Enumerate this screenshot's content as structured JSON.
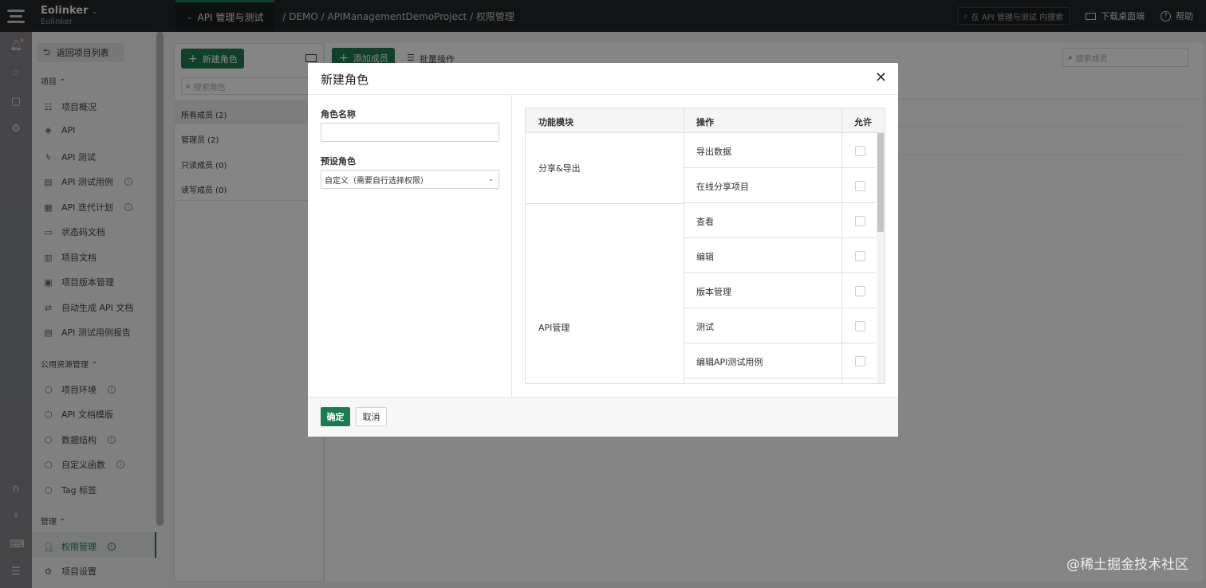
{
  "topbar": {
    "brand_name": "Eolinker",
    "brand_sub": "Eolinker",
    "active_tab": "API 管理与测试",
    "breadcrumb": "/ DEMO / APIManagementDemoProject / 权限管理",
    "search_placeholder": "在 API 管理与测试 内搜索",
    "download_label": "下载桌面端",
    "help_label": "帮助"
  },
  "nav": {
    "back_label": "返回项目列表",
    "group_project": "项目",
    "group_public": "公用资源管理",
    "group_manage": "管理",
    "items": [
      {
        "label": "项目概况",
        "icon": "list-icon"
      },
      {
        "label": "API",
        "icon": "tag-icon"
      },
      {
        "label": "API 测试",
        "icon": "bolt-icon"
      },
      {
        "label": "API 测试用例",
        "icon": "clipboard-icon"
      },
      {
        "label": "API 迭代计划",
        "icon": "calendar-icon"
      },
      {
        "label": "状态码文档",
        "icon": "comment-icon"
      },
      {
        "label": "项目文档",
        "icon": "document-icon"
      },
      {
        "label": "项目版本管理",
        "icon": "versions-icon"
      },
      {
        "label": "自动生成 API 文档",
        "icon": "sync-icon"
      },
      {
        "label": "API 测试用例报告",
        "icon": "report-icon"
      },
      {
        "label": "项目环境",
        "icon": "cube-icon"
      },
      {
        "label": "API 文档模版",
        "icon": "cube-icon"
      },
      {
        "label": "数据结构",
        "icon": "cube-icon"
      },
      {
        "label": "自定义函数",
        "icon": "cube-icon"
      },
      {
        "label": "Tag 标签",
        "icon": "cube-icon"
      },
      {
        "label": "权限管理",
        "icon": "user-icon"
      },
      {
        "label": "项目设置",
        "icon": "gear-icon"
      }
    ]
  },
  "roles": {
    "new_role_label": "新建角色",
    "search_placeholder": "搜索角色",
    "list": [
      "所有成员 (2)",
      "管理员 (2)",
      "只读成员 (0)",
      "读写成员 (0)"
    ]
  },
  "members": {
    "add_member_label": "添加成员",
    "batch_label": "批量操作",
    "search_placeholder": "搜索成员"
  },
  "modal": {
    "title": "新建角色",
    "role_name_label": "角色名称",
    "role_name_value": "",
    "preset_label": "预设角色",
    "preset_value": "自定义（需要自行选择权限）",
    "table_headers": {
      "module": "功能模块",
      "operation": "操作",
      "allow": "允许"
    },
    "modules": [
      {
        "name": "分享&导出",
        "ops": [
          "导出数据",
          "在线分享项目"
        ]
      },
      {
        "name": "API管理",
        "ops": [
          "查看",
          "编辑",
          "版本管理",
          "测试",
          "编辑API测试用例"
        ]
      }
    ],
    "ok_label": "确定",
    "cancel_label": "取消"
  },
  "watermark": "@稀土掘金技术社区",
  "colors": {
    "accent": "#1d7b52",
    "topbar": "#222529"
  }
}
